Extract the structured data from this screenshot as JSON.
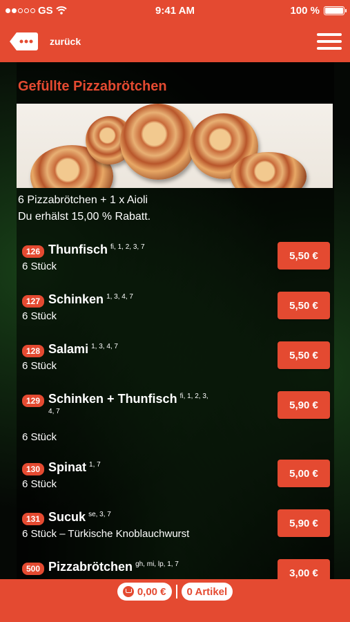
{
  "status": {
    "carrier": "GS",
    "time": "9:41 AM",
    "battery": "100 %",
    "signal_bars_filled": 2,
    "signal_bars_total": 5
  },
  "nav": {
    "back_label": "zurück",
    "back_icon": "more-dots-tag-icon",
    "menu_icon": "hamburger-menu-icon"
  },
  "category": {
    "title": "Gefüllte Pizzabrötchen",
    "description_line1": "6 Pizzabrötchen + 1 x Aioli",
    "description_line2": "Du erhälst 15,00 % Rabatt."
  },
  "items": [
    {
      "number": "126",
      "name": "Thunfisch",
      "allergens": "fi, 1, 2, 3, 7",
      "subtitle": "6 Stück",
      "price": "5,50 €"
    },
    {
      "number": "127",
      "name": "Schinken",
      "allergens": "1, 3, 4, 7",
      "subtitle": "6 Stück",
      "price": "5,50 €"
    },
    {
      "number": "128",
      "name": "Salami",
      "allergens": "1, 3, 4, 7",
      "subtitle": "6 Stück",
      "price": "5,50 €"
    },
    {
      "number": "129",
      "name": "Schinken + Thunfisch",
      "allergens": "fi, 1, 2, 3, 4, 7",
      "subtitle": "6 Stück",
      "price": "5,90 €"
    },
    {
      "number": "130",
      "name": "Spinat",
      "allergens": "1, 7",
      "subtitle": "6 Stück",
      "price": "5,00 €"
    },
    {
      "number": "131",
      "name": "Sucuk",
      "allergens": "se, 3, 7",
      "subtitle": "6 Stück – Türkische Knoblauchwurst",
      "price": "5,90 €"
    },
    {
      "number": "500",
      "name": "Pizzabrötchen",
      "allergens": "gh, mi, lp, 1, 7",
      "subtitle": "",
      "price": "3,00 €"
    }
  ],
  "footer": {
    "cart_total": "0,00 €",
    "article_count": "0 Artikel",
    "cart_icon": "cart-icon"
  },
  "colors": {
    "accent": "#e44a31",
    "background": "#000000",
    "text": "#ffffff"
  }
}
